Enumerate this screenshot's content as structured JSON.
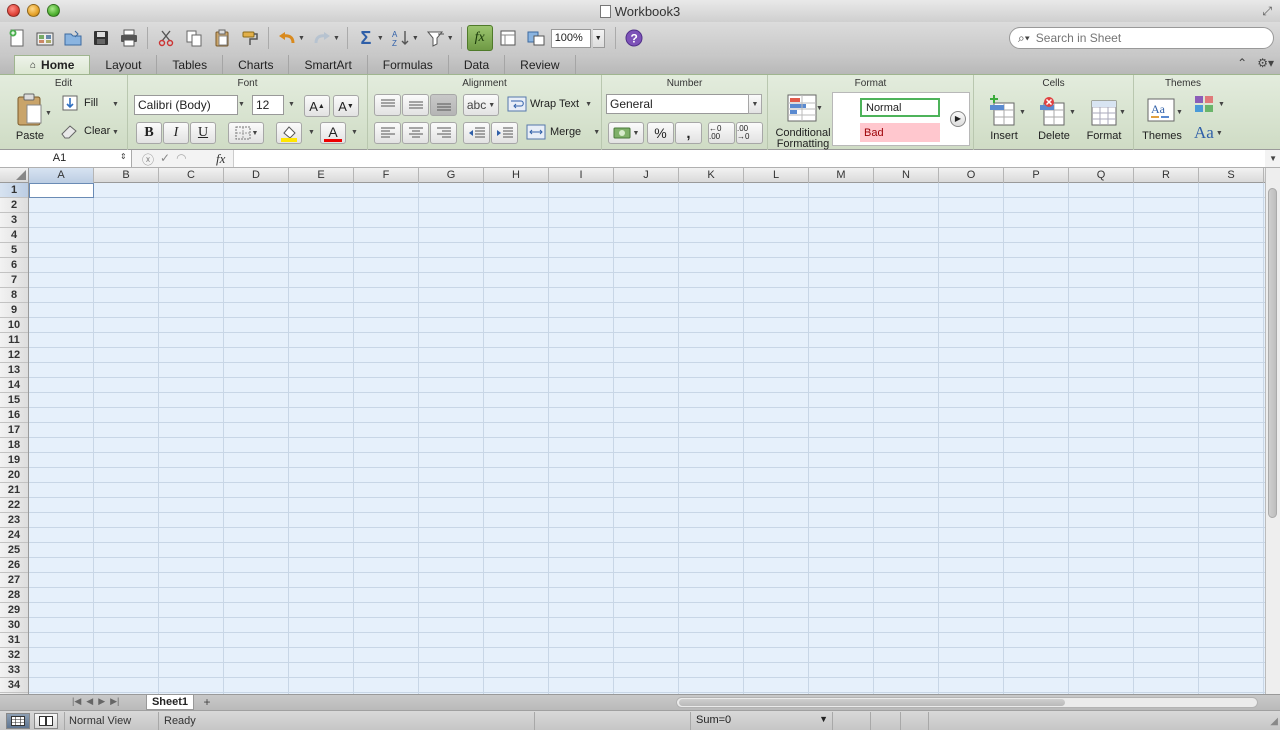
{
  "window": {
    "title": "Workbook3"
  },
  "toolbar": {
    "zoom": "100%",
    "search_placeholder": "Search in Sheet"
  },
  "ribbon_tabs": [
    "Home",
    "Layout",
    "Tables",
    "Charts",
    "SmartArt",
    "Formulas",
    "Data",
    "Review"
  ],
  "ribbon": {
    "edit": {
      "title": "Edit",
      "paste": "Paste",
      "fill": "Fill",
      "clear": "Clear"
    },
    "font": {
      "title": "Font",
      "name": "Calibri (Body)",
      "size": "12",
      "bold": "B",
      "italic": "I",
      "underline": "U",
      "grow": "A",
      "shrink": "A",
      "color": "A"
    },
    "alignment": {
      "title": "Alignment",
      "orient": "abc",
      "wrap_text": "Wrap Text",
      "merge": "Merge"
    },
    "number": {
      "title": "Number",
      "format": "General",
      "percent": "%",
      "comma": ",",
      "inc_dec": "←0 .00",
      "dec_dec": ".00 →0"
    },
    "format": {
      "title": "Format",
      "conditional_1": "Conditional",
      "conditional_2": "Formatting",
      "style_normal": "Normal",
      "style_bad": "Bad"
    },
    "cells": {
      "title": "Cells",
      "insert": "Insert",
      "delete": "Delete",
      "format": "Format"
    },
    "themes": {
      "title": "Themes",
      "themes": "Themes",
      "fonts": "Aa"
    }
  },
  "formula_bar": {
    "name_box": "A1",
    "fx": "fx",
    "value": ""
  },
  "grid": {
    "columns": [
      "A",
      "B",
      "C",
      "D",
      "E",
      "F",
      "G",
      "H",
      "I",
      "J",
      "K",
      "L",
      "M",
      "N",
      "O",
      "P",
      "Q",
      "R",
      "S"
    ],
    "rows": [
      "1",
      "2",
      "3",
      "4",
      "5",
      "6",
      "7",
      "8",
      "9",
      "10",
      "11",
      "12",
      "13",
      "14",
      "15",
      "16",
      "17",
      "18",
      "19",
      "20",
      "21",
      "22",
      "23",
      "24",
      "25",
      "26",
      "27",
      "28",
      "29",
      "30",
      "31",
      "32",
      "33",
      "34"
    ]
  },
  "sheets": {
    "tabs": [
      "Sheet1"
    ],
    "add": "+"
  },
  "status": {
    "view": "Normal View",
    "state": "Ready",
    "sum": "Sum=0"
  },
  "colors": {
    "ribbon": "#d9e5d0",
    "grid": "#e6f0fb",
    "style_normal_border": "#4db35a",
    "style_bad_bg": "#ffc7ce",
    "style_bad_text": "#9c0006"
  }
}
